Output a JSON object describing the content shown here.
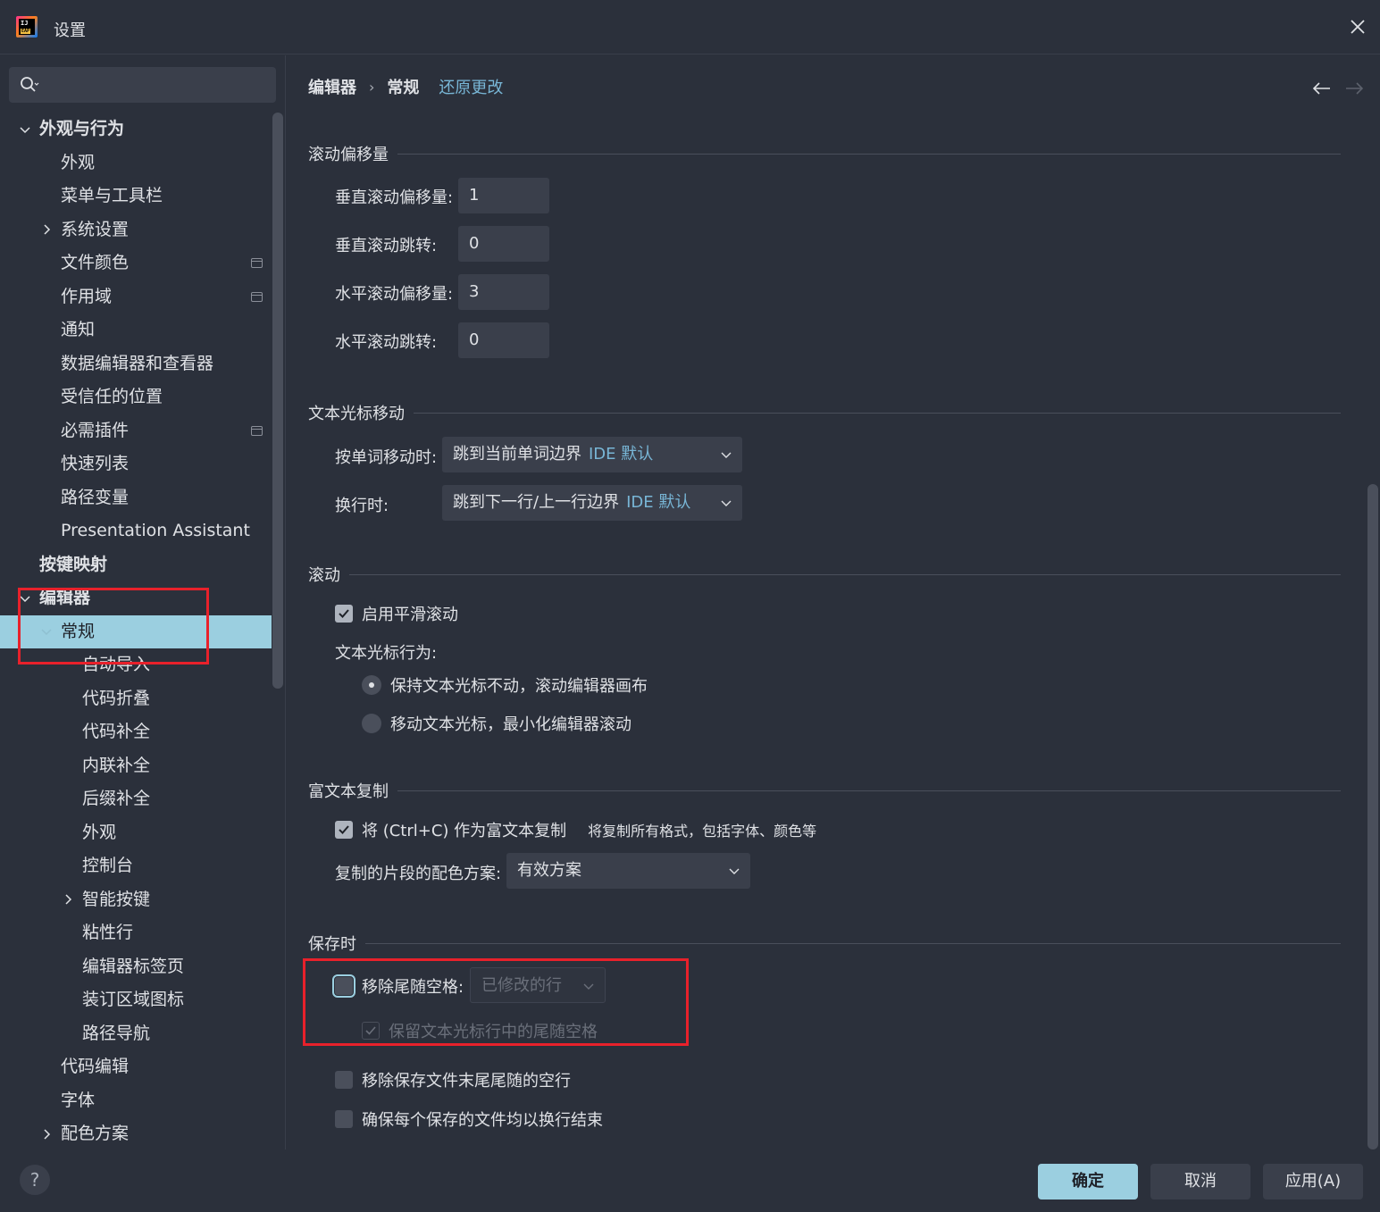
{
  "window": {
    "title": "设置"
  },
  "search": {
    "placeholder": ""
  },
  "sidebar": {
    "items": [
      {
        "label": "外观与行为",
        "level": 0,
        "bold": true,
        "arrow": "down"
      },
      {
        "label": "外观",
        "level": 1
      },
      {
        "label": "菜单与工具栏",
        "level": 1
      },
      {
        "label": "系统设置",
        "level": 1,
        "arrow": "right"
      },
      {
        "label": "文件颜色",
        "level": 1,
        "project": true
      },
      {
        "label": "作用域",
        "level": 1,
        "project": true
      },
      {
        "label": "通知",
        "level": 1
      },
      {
        "label": "数据编辑器和查看器",
        "level": 1
      },
      {
        "label": "受信任的位置",
        "level": 1
      },
      {
        "label": "必需插件",
        "level": 1,
        "project": true
      },
      {
        "label": "快速列表",
        "level": 1
      },
      {
        "label": "路径变量",
        "level": 1
      },
      {
        "label": "Presentation Assistant",
        "level": 1
      },
      {
        "label": "按键映射",
        "level": 0,
        "bold": true
      },
      {
        "label": "编辑器",
        "level": 0,
        "bold": true,
        "arrow": "down"
      },
      {
        "label": "常规",
        "level": 1,
        "arrow": "down",
        "selected": true
      },
      {
        "label": "自动导入",
        "level": 2
      },
      {
        "label": "代码折叠",
        "level": 2
      },
      {
        "label": "代码补全",
        "level": 2
      },
      {
        "label": "内联补全",
        "level": 2
      },
      {
        "label": "后缀补全",
        "level": 2
      },
      {
        "label": "外观",
        "level": 2
      },
      {
        "label": "控制台",
        "level": 2
      },
      {
        "label": "智能按键",
        "level": 2,
        "arrow": "right"
      },
      {
        "label": "粘性行",
        "level": 2
      },
      {
        "label": "编辑器标签页",
        "level": 2
      },
      {
        "label": "装订区域图标",
        "level": 2
      },
      {
        "label": "路径导航",
        "level": 2
      },
      {
        "label": "代码编辑",
        "level": 1
      },
      {
        "label": "字体",
        "level": 1
      },
      {
        "label": "配色方案",
        "level": 1,
        "arrow": "right"
      }
    ]
  },
  "breadcrumb": {
    "parent": "编辑器",
    "current": "常规",
    "revert": "还原更改"
  },
  "scroll_offset": {
    "title": "滚动偏移量",
    "fields": [
      {
        "label": "垂直滚动偏移量:",
        "value": "1"
      },
      {
        "label": "垂直滚动跳转:",
        "value": "0"
      },
      {
        "label": "水平滚动偏移量:",
        "value": "3"
      },
      {
        "label": "水平滚动跳转:",
        "value": "0"
      }
    ]
  },
  "caret_movement": {
    "title": "文本光标移动",
    "word_label": "按单词移动时:",
    "word_value": "跳到当前单词边界",
    "word_hint": "IDE 默认",
    "line_label": "换行时:",
    "line_value": "跳到下一行/上一行边界",
    "line_hint": "IDE 默认"
  },
  "scrolling": {
    "title": "滚动",
    "smooth_label": "启用平滑滚动",
    "smooth_checked": true,
    "caret_behavior_label": "文本光标行为:",
    "radio1": "保持文本光标不动，滚动编辑器画布",
    "radio2": "移动文本光标，最小化编辑器滚动"
  },
  "rich_copy": {
    "title": "富文本复制",
    "copy_label": "将 (Ctrl+C) 作为富文本复制",
    "copy_note": "将复制所有格式，包括字体、颜色等",
    "copy_checked": true,
    "scheme_label": "复制的片段的配色方案:",
    "scheme_value": "有效方案"
  },
  "on_save": {
    "title": "保存时",
    "strip_label": "移除尾随空格:",
    "strip_value": "已修改的行",
    "keep_label": "保留文本光标行中的尾随空格",
    "remove_blank_label": "移除保存文件末尾尾随的空行",
    "ensure_newline_label": "确保每个保存的文件均以换行结束"
  },
  "footer": {
    "help": "?",
    "ok": "确定",
    "cancel": "取消",
    "apply": "应用(A)"
  },
  "colors": {
    "background": "#2b303b",
    "input": "#3a3f4b",
    "accent": "#9bcfe0",
    "link": "#78b6d6",
    "highlight_box": "#e8212b"
  }
}
